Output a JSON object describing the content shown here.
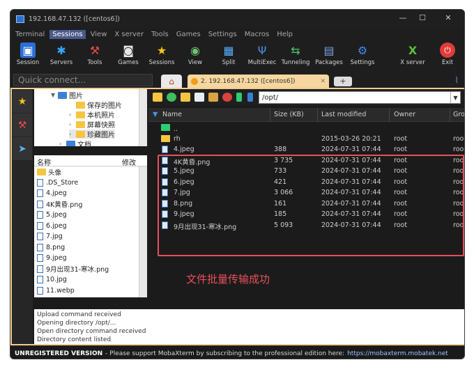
{
  "window": {
    "title": "192.168.47.132 ([centos6])",
    "minimize": "—",
    "maximize": "☐",
    "close": "✕"
  },
  "menu": [
    "Terminal",
    "Sessions",
    "View",
    "X server",
    "Tools",
    "Games",
    "Settings",
    "Macros",
    "Help"
  ],
  "toolbar": [
    {
      "label": "Session",
      "icon": "session-icon"
    },
    {
      "label": "Servers",
      "icon": "servers-icon"
    },
    {
      "label": "Tools",
      "icon": "tools-icon"
    },
    {
      "label": "Games",
      "icon": "games-icon"
    },
    {
      "label": "Sessions",
      "icon": "sessions-star-icon"
    },
    {
      "label": "View",
      "icon": "view-icon"
    },
    {
      "label": "Split",
      "icon": "split-icon"
    },
    {
      "label": "MultiExec",
      "icon": "multiexec-icon"
    },
    {
      "label": "Tunneling",
      "icon": "tunneling-icon"
    },
    {
      "label": "Packages",
      "icon": "packages-icon"
    },
    {
      "label": "Settings",
      "icon": "settings-icon"
    },
    {
      "label": "X server",
      "icon": "xserver-icon"
    },
    {
      "label": "Exit",
      "icon": "exit-icon"
    }
  ],
  "quick_connect": "Quick connect...",
  "session_tab": "2. 192.168.47.132 ([centos6])",
  "tree": {
    "root": "图片",
    "children": [
      "保存的图片",
      "本机照片",
      "屏幕快照",
      "珍藏图片"
    ],
    "partial": "文档"
  },
  "local_list": {
    "col_name": "名称",
    "col_modified": "修改",
    "items": [
      "头像",
      ".DS_Store",
      "4.jpeg",
      "4K黄昏.png",
      "5.jpeg",
      "6.jpeg",
      "7.jpg",
      "8.png",
      "9.jpeg",
      "9月出现31-寒冰.png",
      "10.jpg",
      "11.webp"
    ]
  },
  "remote": {
    "path": "/opt/",
    "columns": {
      "name": "Name",
      "size": "Size (KB)",
      "modified": "Last modified",
      "owner": "Owner",
      "group": "Grou"
    },
    "rows": [
      {
        "name": "..",
        "size": "",
        "modified": "",
        "owner": "",
        "group": ""
      },
      {
        "name": "rh",
        "size": "",
        "modified": "2015-03-26 20:21",
        "owner": "root",
        "group": "root"
      },
      {
        "name": "4.jpeg",
        "size": "388",
        "modified": "2024-07-31 07:44",
        "owner": "root",
        "group": "root"
      },
      {
        "name": "4K黄昏.png",
        "size": "3 735",
        "modified": "2024-07-31 07:44",
        "owner": "root",
        "group": "root"
      },
      {
        "name": "5.jpeg",
        "size": "733",
        "modified": "2024-07-31 07:44",
        "owner": "root",
        "group": "root"
      },
      {
        "name": "6.jpeg",
        "size": "421",
        "modified": "2024-07-31 07:44",
        "owner": "root",
        "group": "root"
      },
      {
        "name": "7.jpg",
        "size": "3 066",
        "modified": "2024-07-31 07:44",
        "owner": "root",
        "group": "root"
      },
      {
        "name": "8.png",
        "size": "161",
        "modified": "2024-07-31 07:44",
        "owner": "root",
        "group": "root"
      },
      {
        "name": "9.jpeg",
        "size": "185",
        "modified": "2024-07-31 07:44",
        "owner": "root",
        "group": "root"
      },
      {
        "name": "9月出现31-寒冰.png",
        "size": "5 093",
        "modified": "2024-07-31 07:44",
        "owner": "root",
        "group": "root"
      }
    ]
  },
  "annotation": "文件批量传输成功",
  "log": [
    "Upload command received",
    "Opening directory /opt/...",
    "Open directory command received",
    "Directory content listed"
  ],
  "status": {
    "unregistered": "UNREGISTERED VERSION",
    "message": "-  Please support MobaXterm by subscribing to the professional edition here:",
    "link": "https://mobaxterm.mobatek.net"
  },
  "colors": {
    "accent_border": "#f2cc8f",
    "highlight": "#e8505b",
    "tab_active": "#f6d7a0"
  }
}
